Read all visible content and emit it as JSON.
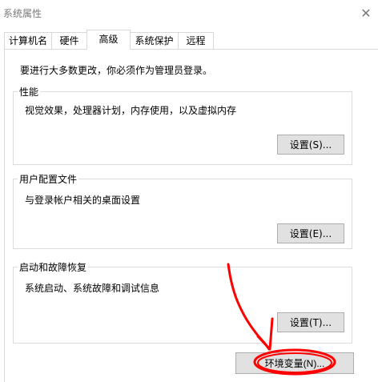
{
  "window": {
    "title": "系统属性",
    "close_icon": "close-icon"
  },
  "tabs": [
    {
      "label": "计算机名"
    },
    {
      "label": "硬件"
    },
    {
      "label": "高级",
      "active": true
    },
    {
      "label": "系统保护"
    },
    {
      "label": "远程"
    }
  ],
  "notice": "要进行大多数更改，你必须作为管理员登录。",
  "groups": [
    {
      "label": "性能",
      "description": "视觉效果，处理器计划，内存使用，以及虚拟内存",
      "button": "设置(S)..."
    },
    {
      "label": "用户配置文件",
      "description": "与登录帐户相关的桌面设置",
      "button": "设置(E)..."
    },
    {
      "label": "启动和故障恢复",
      "description": "系统启动、系统故障和调试信息",
      "button": "设置(T)..."
    }
  ],
  "env_button": "环境变量(N)...",
  "annotation": {
    "color": "#ff0000"
  }
}
